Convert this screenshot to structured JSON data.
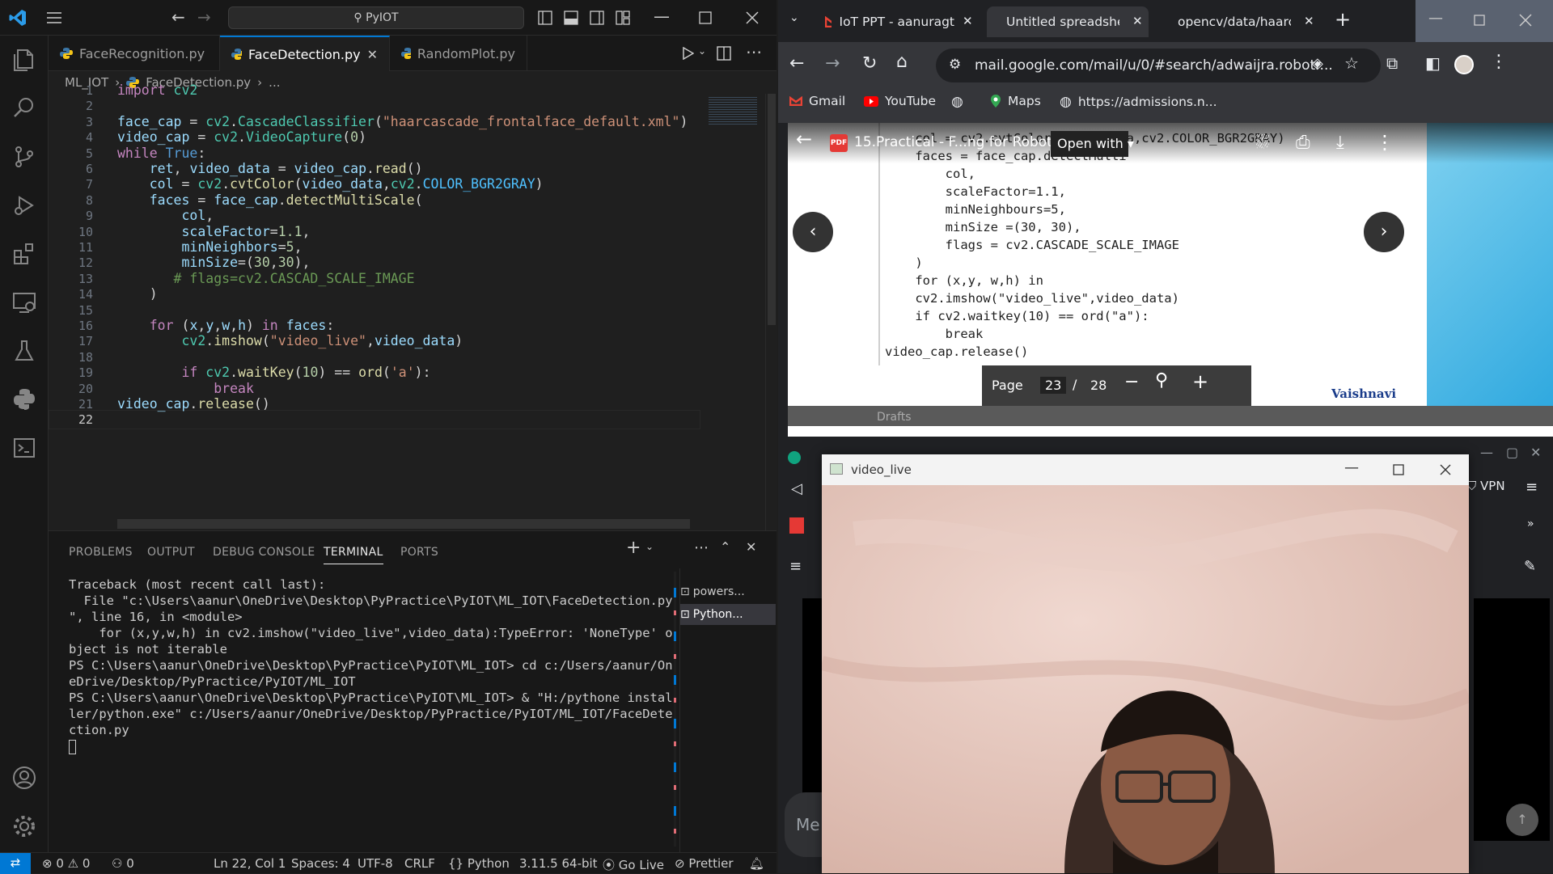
{
  "vscode": {
    "search_text": "PyIOT",
    "tabs": [
      {
        "label": "FaceRecognition.py",
        "active": false
      },
      {
        "label": "FaceDetection.py",
        "active": true
      },
      {
        "label": "RandomPlot.py",
        "active": false
      }
    ],
    "breadcrumb": {
      "folder": "ML_IOT",
      "file": "FaceDetection.py",
      "more": "..."
    },
    "line_numbers": [
      "1",
      "2",
      "3",
      "4",
      "5",
      "6",
      "7",
      "8",
      "9",
      "10",
      "11",
      "12",
      "13",
      "14",
      "15",
      "16",
      "17",
      "18",
      "19",
      "20",
      "21",
      "22"
    ],
    "code_lines": [
      "import cv2",
      "",
      "face_cap = cv2.CascadeClassifier(\"haarcascade_frontalface_default.xml\")",
      "video_cap = cv2.VideoCapture(0)",
      "while True:",
      "    ret, video_data = video_cap.read()",
      "    col = cv2.cvtColor(video_data,cv2.COLOR_BGR2GRAY)",
      "    faces = face_cap.detectMultiScale(",
      "        col,",
      "        scaleFactor=1.1,",
      "        minNeighbors=5,",
      "        minSize=(30,30),",
      "       # flags=cv2.CASCAD_SCALE_IMAGE",
      "    )",
      "",
      "    for (x,y,w,h) in faces:",
      "        cv2.imshow(\"video_live\",video_data)",
      "",
      "        if cv2.waitKey(10) == ord('a'):",
      "            break",
      "video_cap.release()",
      ""
    ],
    "panel_tabs": [
      "PROBLEMS",
      "OUTPUT",
      "DEBUG CONSOLE",
      "TERMINAL",
      "PORTS"
    ],
    "active_panel_tab": "TERMINAL",
    "terminal_lines": [
      "Traceback (most recent call last):",
      "  File \"c:\\Users\\aanur\\OneDrive\\Desktop\\PyPractice\\PyIOT\\ML_IOT\\FaceDetection.py",
      "\", line 16, in <module>",
      "    for (x,y,w,h) in cv2.imshow(\"video_live\",video_data):TypeError: 'NoneType' o",
      "bject is not iterable",
      "PS C:\\Users\\aanur\\OneDrive\\Desktop\\PyPractice\\PyIOT\\ML_IOT> cd c:/Users/aanur/On",
      "eDrive/Desktop/PyPractice/PyIOT/ML_IOT",
      "PS C:\\Users\\aanur\\OneDrive\\Desktop\\PyPractice\\PyIOT\\ML_IOT> & \"H:/pythone instal",
      "ler/python.exe\" c:/Users/aanur/OneDrive/Desktop/PyPractice/PyIOT/ML_IOT/FaceDete",
      "ction.py"
    ],
    "terminal_sessions": [
      "powers...",
      "Python..."
    ],
    "status": {
      "errors": "0",
      "warnings": "0",
      "ports": "0",
      "cursor": "Ln 22, Col 1",
      "spaces": "Spaces: 4",
      "encoding": "UTF-8",
      "eol": "CRLF",
      "language": "Python",
      "interpreter": "3.11.5 64-bit",
      "golive": "Go Live",
      "prettier": "Prettier"
    }
  },
  "chrome": {
    "tabs": [
      {
        "label": "IoT PPT - aanuragt",
        "icon": "gmail-icon"
      },
      {
        "label": "Untitled spreadshe",
        "icon": "sheets-icon"
      },
      {
        "label": "opencv/data/haarc",
        "icon": "github-icon"
      }
    ],
    "url": "mail.google.com/mail/u/0/#search/adwaijra.robotr...",
    "bookmarks": [
      "Gmail",
      "YouTube",
      "Maps",
      "https://admissions.n..."
    ],
    "pdf": {
      "title": "15.Practical - F...ng for Robot.pdf",
      "open_with": "Open with",
      "page_label": "Page",
      "page_current": "23",
      "page_sep": "/",
      "page_total": "28",
      "watermark": "Vaishnavi",
      "behind_text": "Drafts",
      "code_lines": [
        "    col = cv2.cvtColor(video_data,cv2.COLOR_BGR2GRAY)",
        "    faces = face_cap.detectMulti",
        "        col,",
        "        scaleFactor=1.1,",
        "        minNeighbours=5,",
        "        minSize =(30, 30),",
        "        flags = cv2.CASCADE_SCALE_IMAGE",
        "    )",
        "    for (x,y, w,h) in",
        "    cv2.imshow(\"video_live\",video_data)",
        "    if cv2.waitkey(10) == ord(\"a\"):",
        "        break",
        "video_cap.release()"
      ]
    }
  },
  "chat_bg": {
    "vpn": "VPN",
    "message_placeholder": "Me"
  },
  "video_window": {
    "title": "video_live"
  }
}
